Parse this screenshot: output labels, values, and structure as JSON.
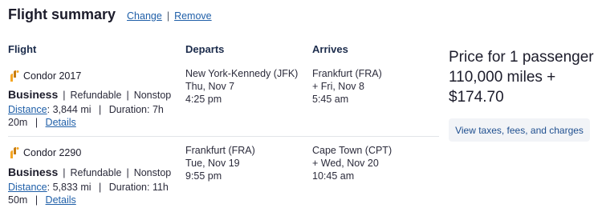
{
  "header": {
    "title": "Flight summary",
    "change_label": "Change",
    "separator": "|",
    "remove_label": "Remove"
  },
  "columns": {
    "flight": "Flight",
    "departs": "Departs",
    "arrives": "Arrives"
  },
  "segments": [
    {
      "airline": "Condor 2017",
      "cabin": "Business",
      "refund": "Refundable",
      "stops": "Nonstop",
      "distance_label": "Distance",
      "distance_value": ": 3,844 mi",
      "duration": "Duration: 7h 20m",
      "details_label": "Details",
      "depart_airport": "New York-Kennedy (JFK)",
      "depart_date": "Thu, Nov 7",
      "depart_time": "4:25 pm",
      "arrive_airport": "Frankfurt (FRA)",
      "arrive_date": "+ Fri, Nov 8",
      "arrive_time": "5:45 am"
    },
    {
      "airline": "Condor 2290",
      "cabin": "Business",
      "refund": "Refundable",
      "stops": "Nonstop",
      "distance_label": "Distance",
      "distance_value": ": 5,833 mi",
      "duration": "Duration: 11h 50m",
      "details_label": "Details",
      "depart_airport": "Frankfurt (FRA)",
      "depart_date": "Tue, Nov 19",
      "depart_time": "9:55 pm",
      "arrive_airport": "Cape Town (CPT)",
      "arrive_date": "+ Wed, Nov 20",
      "arrive_time": "10:45 am"
    }
  ],
  "price": {
    "text": "Price for 1 passenger 110,000 miles + $174.70",
    "taxes_button": "View taxes, fees, and charges"
  },
  "colors": {
    "link": "#1f5fa8",
    "logo_orange": "#f5a623",
    "logo_dark": "#c87d10"
  },
  "icons": {
    "airline_logo": "condor-logo-icon"
  }
}
